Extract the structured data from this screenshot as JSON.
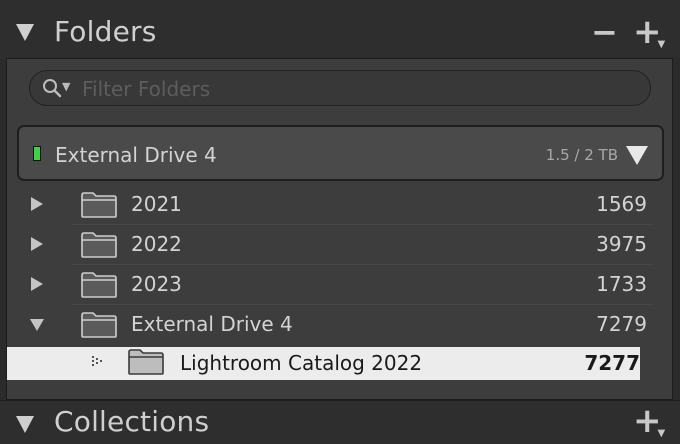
{
  "folders_panel": {
    "title": "Folders",
    "minus_label": "−",
    "plus_label": "+",
    "search": {
      "placeholder": "Filter Folders",
      "value": ""
    }
  },
  "volume": {
    "name": "External Drive 4",
    "size": "1.5 / 2 TB",
    "status_color": "#3fd14a"
  },
  "folders": [
    {
      "label": "2021",
      "count": "1569",
      "expanded": false
    },
    {
      "label": "2022",
      "count": "3975",
      "expanded": false
    },
    {
      "label": "2023",
      "count": "1733",
      "expanded": false
    },
    {
      "label": "External Drive 4",
      "count": "7279",
      "expanded": true
    }
  ],
  "selected_folder": {
    "label": "Lightroom Catalog 2022",
    "count": "7277"
  },
  "collections_panel": {
    "title": "Collections",
    "plus_label": "+"
  }
}
